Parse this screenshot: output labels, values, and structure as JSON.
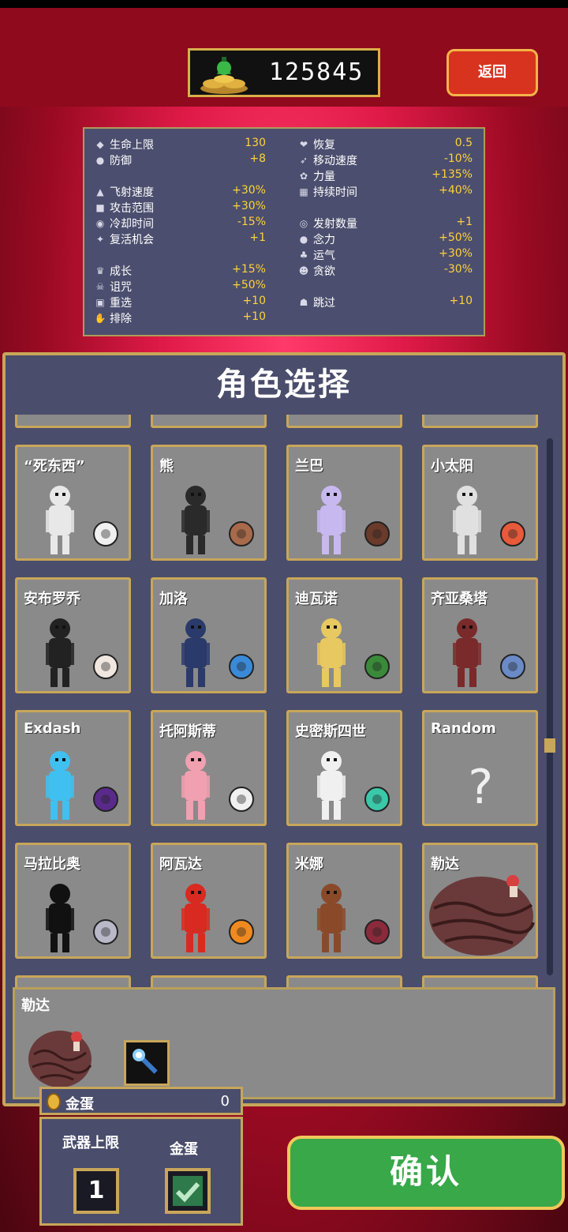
{
  "currency": {
    "amount": "125845",
    "icon": "coin-bag-icon"
  },
  "back_label": "返回",
  "stats": {
    "left": [
      {
        "icon": "heart-icon",
        "label": "生命上限",
        "value": "130"
      },
      {
        "icon": "armor-icon",
        "label": "防御",
        "value": "+8"
      },
      {
        "icon": "gauntlet-icon",
        "label": "飞射速度",
        "value": "+30%"
      },
      {
        "icon": "candelabra-icon",
        "label": "攻击范围",
        "value": "+30%"
      },
      {
        "icon": "tome-icon",
        "label": "冷却时间",
        "value": "-15%"
      },
      {
        "icon": "tiragisu-icon",
        "label": "复活机会",
        "value": "+1"
      },
      {
        "icon": "crown-icon",
        "label": "成长",
        "value": "+15%"
      },
      {
        "icon": "skull-icon",
        "label": "诅咒",
        "value": "+50%"
      },
      {
        "icon": "dice-icon",
        "label": "重选",
        "value": "+10"
      },
      {
        "icon": "hand-icon",
        "label": "排除",
        "value": "+10"
      }
    ],
    "right": [
      {
        "icon": "pummarola-icon",
        "label": "恢复",
        "value": "0.5"
      },
      {
        "icon": "wings-icon",
        "label": "移动速度",
        "value": "-10%"
      },
      {
        "icon": "spinach-icon",
        "label": "力量",
        "value": "+135%"
      },
      {
        "icon": "spellbinder-icon",
        "label": "持续时间",
        "value": "+40%"
      },
      {
        "icon": "duplicator-icon",
        "label": "发射数量",
        "value": "+1"
      },
      {
        "icon": "attractorb-icon",
        "label": "念力",
        "value": "+50%"
      },
      {
        "icon": "clover-icon",
        "label": "运气",
        "value": "+30%"
      },
      {
        "icon": "greed-icon",
        "label": "贪欲",
        "value": "-30%"
      },
      {
        "icon": "skip-icon",
        "label": "跳过",
        "value": "+10"
      }
    ]
  },
  "panel_title": "角色选择",
  "characters": [
    {
      "name": "“死东西”",
      "sprite": "skeleton-sprite-icon",
      "weapon": "bone-icon"
    },
    {
      "name": "熊",
      "sprite": "panda-sprite-icon",
      "weapon": "shield-icon"
    },
    {
      "name": "兰巴",
      "sprite": "ghost-lady-sprite-icon",
      "weapon": "wheel-icon"
    },
    {
      "name": "小太阳",
      "sprite": "dog-sprite-icon",
      "weapon": "flower-icon"
    },
    {
      "name": "安布罗乔",
      "sprite": "gentleman-sprite-icon",
      "weapon": "egg-icon"
    },
    {
      "name": "加洛",
      "sprite": "wizard-sprite-icon",
      "weapon": "wand-icon"
    },
    {
      "name": "迪瓦诺",
      "sprite": "pope-sprite-icon",
      "weapon": "leaf-icon"
    },
    {
      "name": "齐亚桑塔",
      "sprite": "bard-sprite-icon",
      "weapon": "ring-icon"
    },
    {
      "name": "Exdash",
      "sprite": "cyan-ghost-sprite-icon",
      "weapon": "witch-hat-icon"
    },
    {
      "name": "托阿斯蒂",
      "sprite": "pink-ghost-sprite-icon",
      "weapon": "bird-icon"
    },
    {
      "name": "史密斯四世",
      "sprite": "white-ghost-sprite-icon",
      "weapon": "parrot-icon"
    },
    {
      "name": "Random",
      "sprite": "question-mark-icon",
      "weapon": ""
    },
    {
      "name": "马拉比奥",
      "sprite": "shadow-sprite-icon",
      "weapon": "knives-icon"
    },
    {
      "name": "阿瓦达",
      "sprite": "demon-sprite-icon",
      "weapon": "fire-icon"
    },
    {
      "name": "米娜",
      "sprite": "werewolf-sprite-icon",
      "weapon": "whip-icon"
    },
    {
      "name": "勒达",
      "sprite": "brain-blob-sprite-icon",
      "weapon": ""
    }
  ],
  "selected": {
    "name": "勒达",
    "sprite": "brain-blob-sprite-icon",
    "weapon": "magic-wand-icon"
  },
  "golden_egg": {
    "label": "金蛋",
    "count": "0"
  },
  "options": {
    "weapon_limit_label": "武器上限",
    "weapon_limit_value": "1",
    "golden_egg_label": "金蛋",
    "golden_egg_checked": true
  },
  "confirm_label": "确认"
}
